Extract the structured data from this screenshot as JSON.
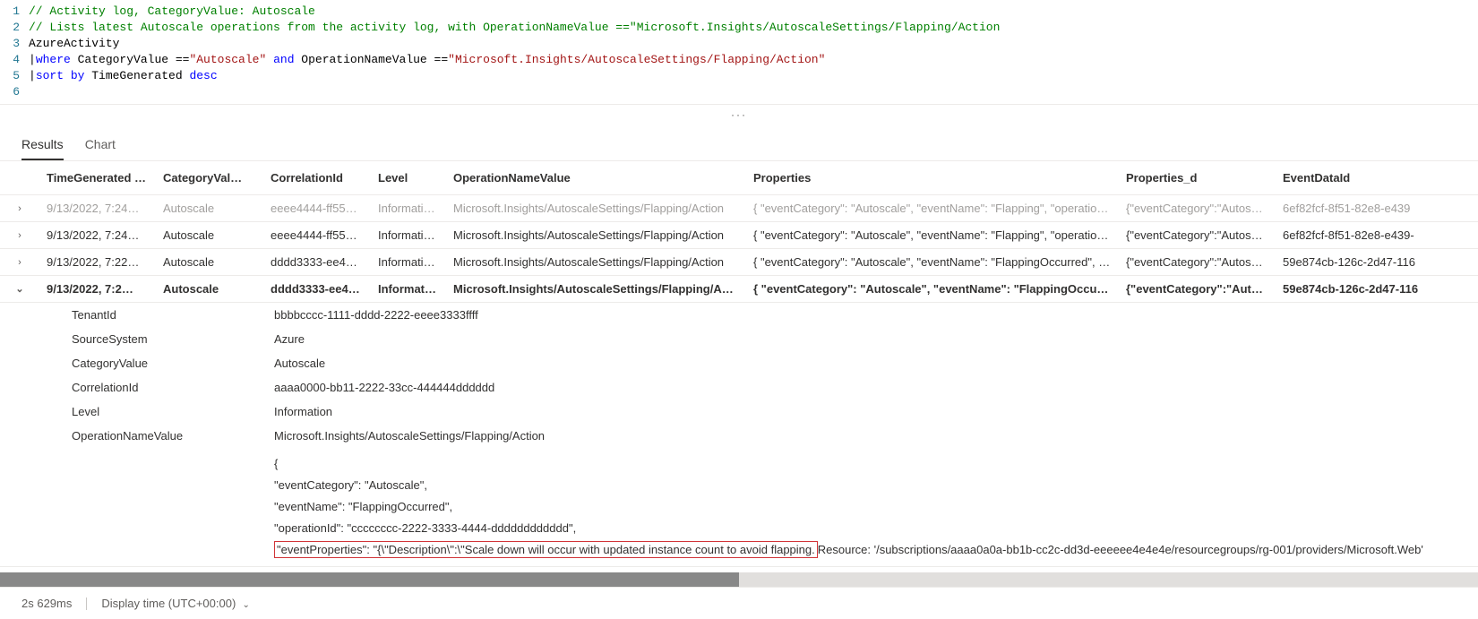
{
  "editor": {
    "lines": [
      {
        "n": "1",
        "segs": [
          {
            "t": "// Activity log, CategoryValue: Autoscale",
            "c": "tok-comment"
          }
        ]
      },
      {
        "n": "2",
        "segs": [
          {
            "t": "// Lists latest Autoscale operations from the activity log, with OperationNameValue ==\"Microsoft.Insights/AutoscaleSettings/Flapping/Action",
            "c": "tok-comment"
          }
        ]
      },
      {
        "n": "3",
        "segs": [
          {
            "t": "AzureActivity",
            "c": "tok-ident"
          }
        ]
      },
      {
        "n": "4",
        "segs": [
          {
            "t": "|",
            "c": "tok-op"
          },
          {
            "t": "where",
            "c": "tok-keyword"
          },
          {
            "t": " CategoryValue ==",
            "c": "tok-ident"
          },
          {
            "t": "\"Autoscale\"",
            "c": "tok-string"
          },
          {
            "t": " ",
            "c": "tok-ident"
          },
          {
            "t": "and",
            "c": "tok-keyword"
          },
          {
            "t": " OperationNameValue ==",
            "c": "tok-ident"
          },
          {
            "t": "\"Microsoft.Insights/AutoscaleSettings/Flapping/Action\"",
            "c": "tok-string"
          }
        ]
      },
      {
        "n": "5",
        "segs": [
          {
            "t": "|",
            "c": "tok-op"
          },
          {
            "t": "sort by",
            "c": "tok-keyword"
          },
          {
            "t": " TimeGenerated ",
            "c": "tok-ident"
          },
          {
            "t": "desc",
            "c": "tok-keyword"
          }
        ]
      },
      {
        "n": "6",
        "segs": [
          {
            "t": "",
            "c": "tok-ident"
          }
        ]
      }
    ]
  },
  "ellipsis": "···",
  "tabs": {
    "results": "Results",
    "chart": "Chart"
  },
  "columns": {
    "time": "TimeGenerated [U…",
    "cat": "CategoryVal…",
    "corr": "CorrelationId",
    "lvl": "Level",
    "op": "OperationNameValue",
    "prop": "Properties",
    "propd": "Properties_d",
    "evt": "EventDataId"
  },
  "rows": [
    {
      "faded": true,
      "expand": "›",
      "time": "9/13/2022, 7:24…",
      "cat": "Autoscale",
      "corr": "eeee4444-ff55…",
      "lvl": "Informati…",
      "op": "Microsoft.Insights/AutoscaleSettings/Flapping/Action",
      "prop": "{ \"eventCategory\": \"Autoscale\", \"eventName\": \"Flapping\", \"operationI…",
      "propd": "{\"eventCategory\":\"Autosca…",
      "evt": "6ef82fcf-8f51-82e8-e439"
    },
    {
      "faded": false,
      "expand": "›",
      "time": "9/13/2022, 7:24…",
      "cat": "Autoscale",
      "corr": "eeee4444-ff55…",
      "lvl": "Informati…",
      "op": "Microsoft.Insights/AutoscaleSettings/Flapping/Action",
      "prop": "{ \"eventCategory\": \"Autoscale\", \"eventName\": \"Flapping\", \"operationI…",
      "propd": "{\"eventCategory\":\"Autosca…",
      "evt": "6ef82fcf-8f51-82e8-e439-"
    },
    {
      "faded": false,
      "expand": "›",
      "time": "9/13/2022, 7:22…",
      "cat": "Autoscale",
      "corr": "dddd3333-ee44…",
      "lvl": "Informati…",
      "op": "Microsoft.Insights/AutoscaleSettings/Flapping/Action",
      "prop": "{ \"eventCategory\": \"Autoscale\", \"eventName\": \"FlappingOccurred\", \"o…",
      "propd": "{\"eventCategory\":\"Autosca…",
      "evt": "59e874cb-126c-2d47-116"
    },
    {
      "faded": false,
      "expanded": true,
      "expand": "⌄",
      "time": "9/13/2022, 7:2…",
      "cat": "Autoscale",
      "corr": "dddd3333-ee44…",
      "lvl": "Informat…",
      "op": "Microsoft.Insights/AutoscaleSettings/Flapping/Action",
      "prop": "{ \"eventCategory\": \"Autoscale\", \"eventName\": \"FlappingOccurred\",…",
      "propd": "{\"eventCategory\":\"Autosc…",
      "evt": "59e874cb-126c-2d47-116"
    }
  ],
  "detail": {
    "pairs": [
      {
        "k": "TenantId",
        "v": "bbbbcccc-1111-dddd-2222-eeee3333ffff"
      },
      {
        "k": "SourceSystem",
        "v": "Azure"
      },
      {
        "k": "CategoryValue",
        "v": "Autoscale"
      },
      {
        "k": "CorrelationId",
        "v": "aaaa0000-bb11-2222-33cc-444444dddddd"
      },
      {
        "k": "Level",
        "v": "Information"
      },
      {
        "k": "OperationNameValue",
        "v": "Microsoft.Insights/AutoscaleSettings/Flapping/Action"
      }
    ],
    "json": {
      "l1": "{",
      "l2": "\"eventCategory\": \"Autoscale\",",
      "l3": "\"eventName\": \"FlappingOccurred\",",
      "l4": "\"operationId\":  \"cccccccc-2222-3333-4444-dddddddddddd\",",
      "l5a": "\"eventProperties\": \"{\\\"Description\\\":\\\"Scale down will occur with updated instance count to avoid flapping.",
      "l5b": "Resource:  '/subscriptions/aaaa0a0a-bb1b-cc2c-dd3d-eeeeee4e4e4e/resourcegroups/rg-001/providers/Microsoft.Web'"
    }
  },
  "status": {
    "time": "2s 629ms",
    "tz": "Display time (UTC+00:00)"
  }
}
